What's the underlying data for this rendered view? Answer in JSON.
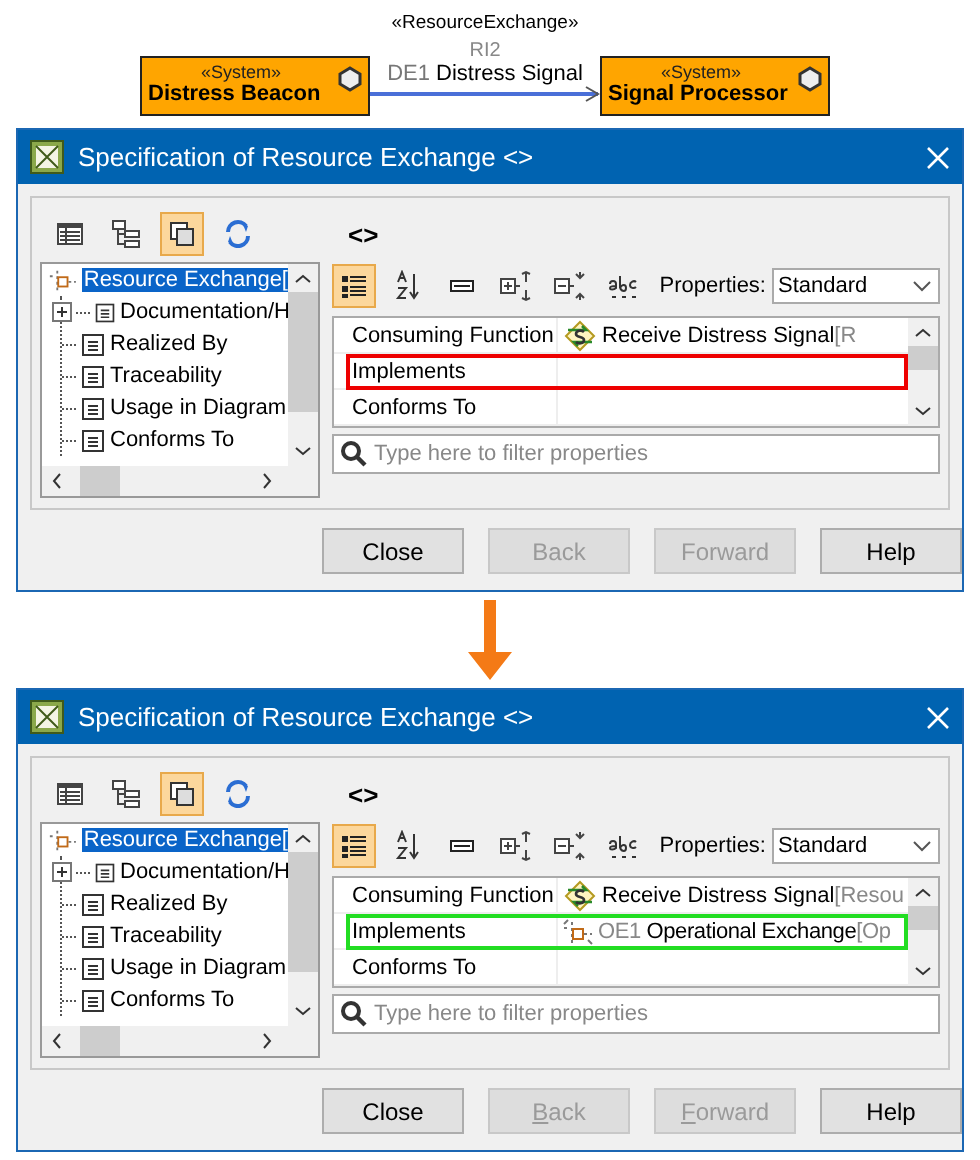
{
  "diagram": {
    "source": {
      "stereotype": "«System»",
      "name": "Distress Beacon"
    },
    "target": {
      "stereotype": "«System»",
      "name": "Signal Processor"
    },
    "connector": {
      "stereotype": "«ResourceExchange»",
      "ref": "RI2",
      "id": "DE1",
      "name": "Distress Signal"
    }
  },
  "dialogs": [
    {
      "title": "Specification of Resource Exchange <>",
      "element": "<>",
      "toolbar": [
        {
          "kind": "table",
          "selected": false
        },
        {
          "kind": "tree",
          "selected": false
        },
        {
          "kind": "copy",
          "selected": true
        },
        {
          "kind": "refresh",
          "selected": false
        }
      ],
      "tree": [
        {
          "label": "Resource Exchange[",
          "selected": true,
          "children": [
            {
              "label": "Documentation/H",
              "collapsed": true
            },
            {
              "label": "Realized By",
              "collapsed": false
            },
            {
              "label": "Traceability",
              "collapsed": false
            },
            {
              "label": "Usage in Diagram",
              "collapsed": false
            },
            {
              "label": "Conforms To",
              "collapsed": false
            }
          ]
        }
      ],
      "prop_toolbar": [
        {
          "kind": "categorized",
          "selected": true
        },
        {
          "kind": "sort",
          "selected": false
        },
        {
          "kind": "note",
          "selected": false
        },
        {
          "kind": "expand",
          "selected": false
        },
        {
          "kind": "collapse",
          "selected": false
        },
        {
          "kind": "spelling",
          "selected": false
        }
      ],
      "properties": {
        "label": "Properties:",
        "value": "Standard"
      },
      "rows": [
        {
          "name": "Consuming Function",
          "value": {
            "kind": "function",
            "name": "Receive Distress Signal",
            "suffix": "[R"
          }
        },
        {
          "name": "Implements",
          "color": "#ee0000"
        },
        {
          "name": "Conforms To"
        }
      ],
      "filter": {
        "placeholder": "Type here to filter properties"
      },
      "buttons": [
        {
          "label": "Close",
          "disabled": false,
          "mnemonic": false
        },
        {
          "label": "Back",
          "disabled": true,
          "mnemonic": false
        },
        {
          "label": "Forward",
          "disabled": true,
          "mnemonic": false
        },
        {
          "label": "Help",
          "disabled": false,
          "mnemonic": false
        }
      ]
    },
    {
      "title": "Specification of Resource Exchange <>",
      "element": "<>",
      "toolbar": [
        {
          "kind": "table",
          "selected": false
        },
        {
          "kind": "tree",
          "selected": false
        },
        {
          "kind": "copy",
          "selected": true
        },
        {
          "kind": "refresh",
          "selected": false
        }
      ],
      "tree": [
        {
          "label": "Resource Exchange[",
          "selected": true,
          "children": [
            {
              "label": "Documentation/H",
              "collapsed": true
            },
            {
              "label": "Realized By",
              "collapsed": false
            },
            {
              "label": "Traceability",
              "collapsed": false
            },
            {
              "label": "Usage in Diagram",
              "collapsed": false
            },
            {
              "label": "Conforms To",
              "collapsed": false
            }
          ]
        }
      ],
      "prop_toolbar": [
        {
          "kind": "categorized",
          "selected": true
        },
        {
          "kind": "sort",
          "selected": false
        },
        {
          "kind": "note",
          "selected": false
        },
        {
          "kind": "expand",
          "selected": false
        },
        {
          "kind": "collapse",
          "selected": false
        },
        {
          "kind": "spelling",
          "selected": false
        }
      ],
      "properties": {
        "label": "Properties:",
        "value": "Standard"
      },
      "rows": [
        {
          "name": "Consuming Function",
          "value": {
            "kind": "function",
            "name": "Receive Distress Signal",
            "suffix": "[Resou"
          }
        },
        {
          "name": "Implements",
          "color": "#22dd22",
          "value": {
            "kind": "exchange",
            "id": "OE1",
            "name": "Operational Exchange",
            "suffix": "[Op"
          }
        },
        {
          "name": "Conforms To"
        }
      ],
      "filter": {
        "placeholder": "Type here to filter properties"
      },
      "buttons": [
        {
          "label": "Close",
          "disabled": false,
          "mnemonic": false
        },
        {
          "label": "Back",
          "disabled": true,
          "mnemonic": true
        },
        {
          "label": "Forward",
          "disabled": true,
          "mnemonic": true
        },
        {
          "label": "Help",
          "disabled": false,
          "mnemonic": false
        }
      ]
    }
  ]
}
